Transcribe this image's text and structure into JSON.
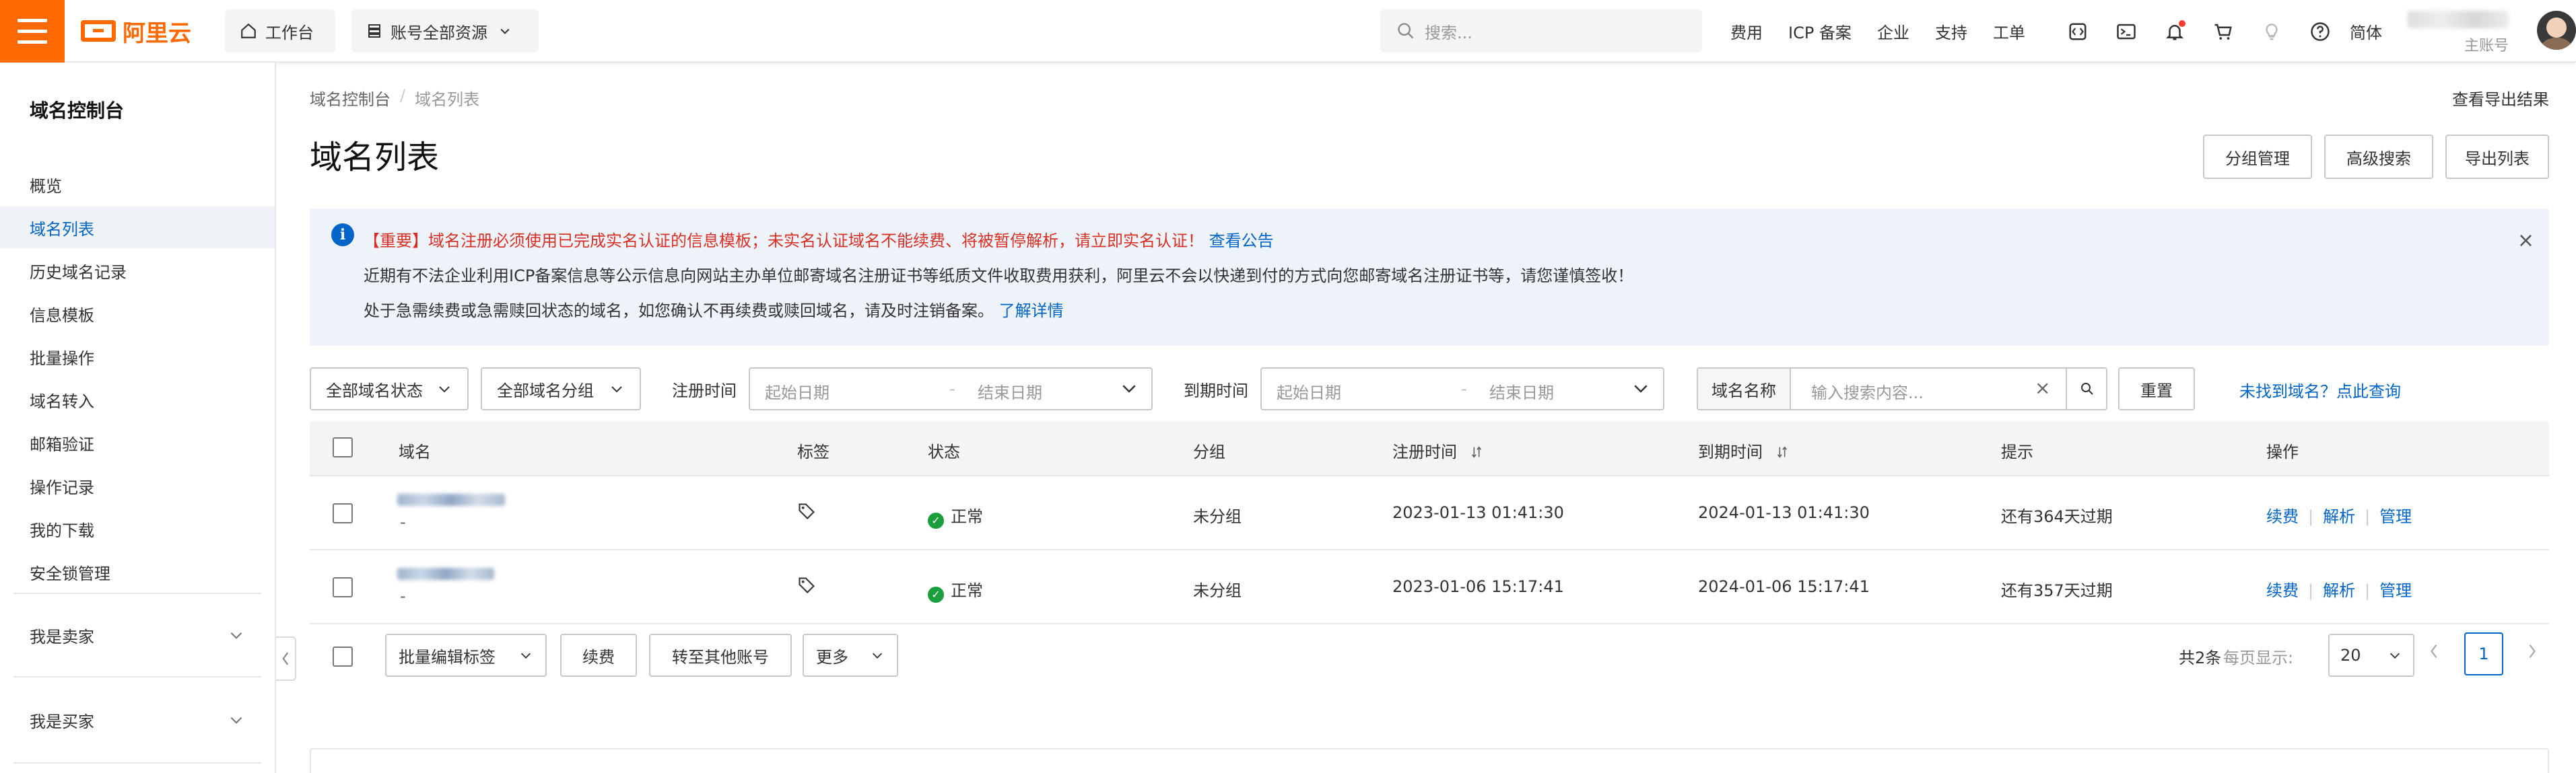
{
  "brand": {
    "logo_text": "阿里云",
    "accent": "#ff6a00",
    "link_color": "#0064c8"
  },
  "topbar": {
    "workbench": "工作台",
    "resources": "账号全部资源",
    "search_placeholder": "搜索...",
    "links": [
      "费用",
      "ICP 备案",
      "企业",
      "支持",
      "工单"
    ],
    "icons": [
      "code-icon",
      "terminal-icon",
      "bell-icon",
      "cart-icon",
      "lightbulb-icon",
      "help-icon"
    ],
    "language": "简体",
    "account_role": "主账号"
  },
  "sidebar": {
    "title": "域名控制台",
    "items": [
      {
        "label": "概览",
        "active": false
      },
      {
        "label": "域名列表",
        "active": true
      },
      {
        "label": "历史域名记录",
        "active": false
      },
      {
        "label": "信息模板",
        "active": false
      },
      {
        "label": "批量操作",
        "active": false
      },
      {
        "label": "域名转入",
        "active": false
      },
      {
        "label": "邮箱验证",
        "active": false
      },
      {
        "label": "操作记录",
        "active": false
      },
      {
        "label": "我的下载",
        "active": false
      },
      {
        "label": "安全锁管理",
        "active": false
      }
    ],
    "groups": [
      {
        "label": "我是卖家"
      },
      {
        "label": "我是买家"
      }
    ]
  },
  "breadcrumb": {
    "root": "域名控制台",
    "sep": "/",
    "current": "域名列表"
  },
  "export_result": "查看导出结果",
  "page_title": "域名列表",
  "header_buttons": {
    "group_manage": "分组管理",
    "advanced_search": "高级搜索",
    "export_list": "导出列表"
  },
  "notice": {
    "line1_warn": "【重要】域名注册必须使用已完成实名认证的信息模板；未实名认证域名不能续费、将被暂停解析，请立即实名认证！",
    "line1_link": "查看公告",
    "line2": "近期有不法企业利用ICP备案信息等公示信息向网站主办单位邮寄域名注册证书等纸质文件收取费用获利，阿里云不会以快递到付的方式向您邮寄域名注册证书等，请您谨慎签收！",
    "line3": "处于急需续费或急需赎回状态的域名，如您确认不再续费或赎回域名，请及时注销备案。",
    "line3_link": "了解详情"
  },
  "filters": {
    "status": "全部域名状态",
    "group": "全部域名分组",
    "reg_label": "注册时间",
    "exp_label": "到期时间",
    "start_placeholder": "起始日期",
    "end_placeholder": "结束日期",
    "range_sep": "-",
    "search_label": "域名名称",
    "search_placeholder": "输入搜索内容...",
    "reset": "重置",
    "not_found_link": "未找到域名？点此查询"
  },
  "table": {
    "columns": {
      "domain": "域名",
      "tag": "标签",
      "status": "状态",
      "group": "分组",
      "reg_time": "注册时间",
      "exp_time": "到期时间",
      "hint": "提示",
      "ops": "操作"
    },
    "rows": [
      {
        "domain_sub": "-",
        "status": "正常",
        "group": "未分组",
        "reg_time": "2023-01-13 01:41:30",
        "exp_time": "2024-01-13 01:41:30",
        "hint": "还有364天过期"
      },
      {
        "domain_sub": "-",
        "status": "正常",
        "group": "未分组",
        "reg_time": "2023-01-06 15:17:41",
        "exp_time": "2024-01-06 15:17:41",
        "hint": "还有357天过期"
      }
    ],
    "ops": {
      "renew": "续费",
      "dns": "解析",
      "manage": "管理",
      "sep": "|"
    },
    "status_color": "#1b9e3e"
  },
  "footer": {
    "batch_tag": "批量编辑标签",
    "renew": "续费",
    "transfer": "转至其他账号",
    "more": "更多",
    "total": "共2条",
    "per_page_label": "每页显示:",
    "per_page": "20",
    "current_page": "1"
  }
}
